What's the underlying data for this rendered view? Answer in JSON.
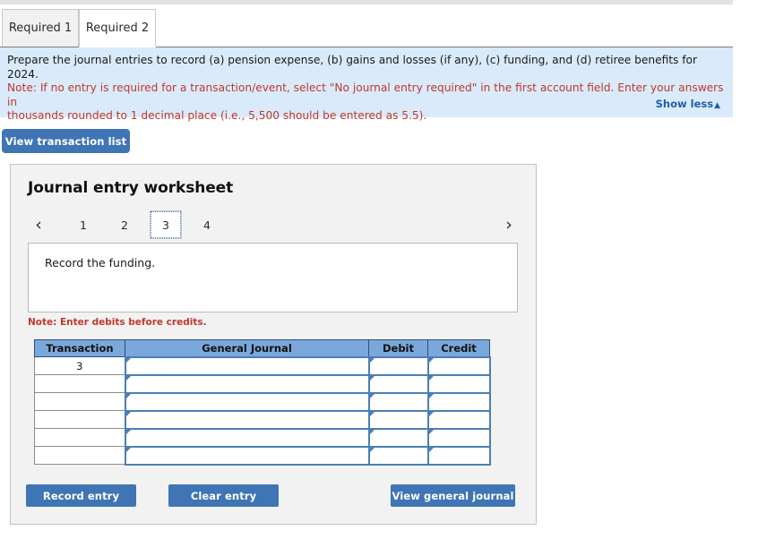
{
  "tabs": [
    {
      "label": "Required 1",
      "active": false
    },
    {
      "label": "Required 2",
      "active": true
    }
  ],
  "instructions": {
    "line1": "Prepare the journal entries to record (a) pension expense, (b) gains and losses (if any), (c) funding, and (d) retiree benefits for 2024.",
    "line2": "Note: If no entry is required for a transaction/event, select \"No journal entry required\" in the first account field. Enter your answers in",
    "line3": "thousands rounded to 1 decimal place (i.e., 5,500 should be entered as 5.5).",
    "show_less_label": "Show less",
    "show_less_caret": "▲"
  },
  "toolbar": {
    "view_transaction_list_label": "View transaction list"
  },
  "worksheet": {
    "title": "Journal entry worksheet",
    "pager": {
      "prev_icon": "‹",
      "next_icon": "›",
      "pages": [
        "1",
        "2",
        "3",
        "4"
      ],
      "active_page": "3"
    },
    "description": "Record the funding.",
    "note": "Note: Enter debits before credits.",
    "table": {
      "headers": [
        "Transaction",
        "General Journal",
        "Debit",
        "Credit"
      ],
      "rows": [
        {
          "transaction": "3",
          "general_journal": "",
          "debit": "",
          "credit": ""
        },
        {
          "transaction": "",
          "general_journal": "",
          "debit": "",
          "credit": ""
        },
        {
          "transaction": "",
          "general_journal": "",
          "debit": "",
          "credit": ""
        },
        {
          "transaction": "",
          "general_journal": "",
          "debit": "",
          "credit": ""
        },
        {
          "transaction": "",
          "general_journal": "",
          "debit": "",
          "credit": ""
        },
        {
          "transaction": "",
          "general_journal": "",
          "debit": "",
          "credit": ""
        }
      ]
    },
    "buttons": {
      "record_entry": "Record entry",
      "clear_entry": "Clear entry",
      "view_general_journal": "View general journal"
    }
  },
  "colors": {
    "accent_blue": "#3f75b5",
    "header_blue": "#7aa8da",
    "panel_blue": "#d9eafa",
    "panel_gray": "#f2f2f2",
    "note_red": "#c0392b",
    "link_blue": "#1b5fa8",
    "input_border": "#4a7fb5"
  }
}
